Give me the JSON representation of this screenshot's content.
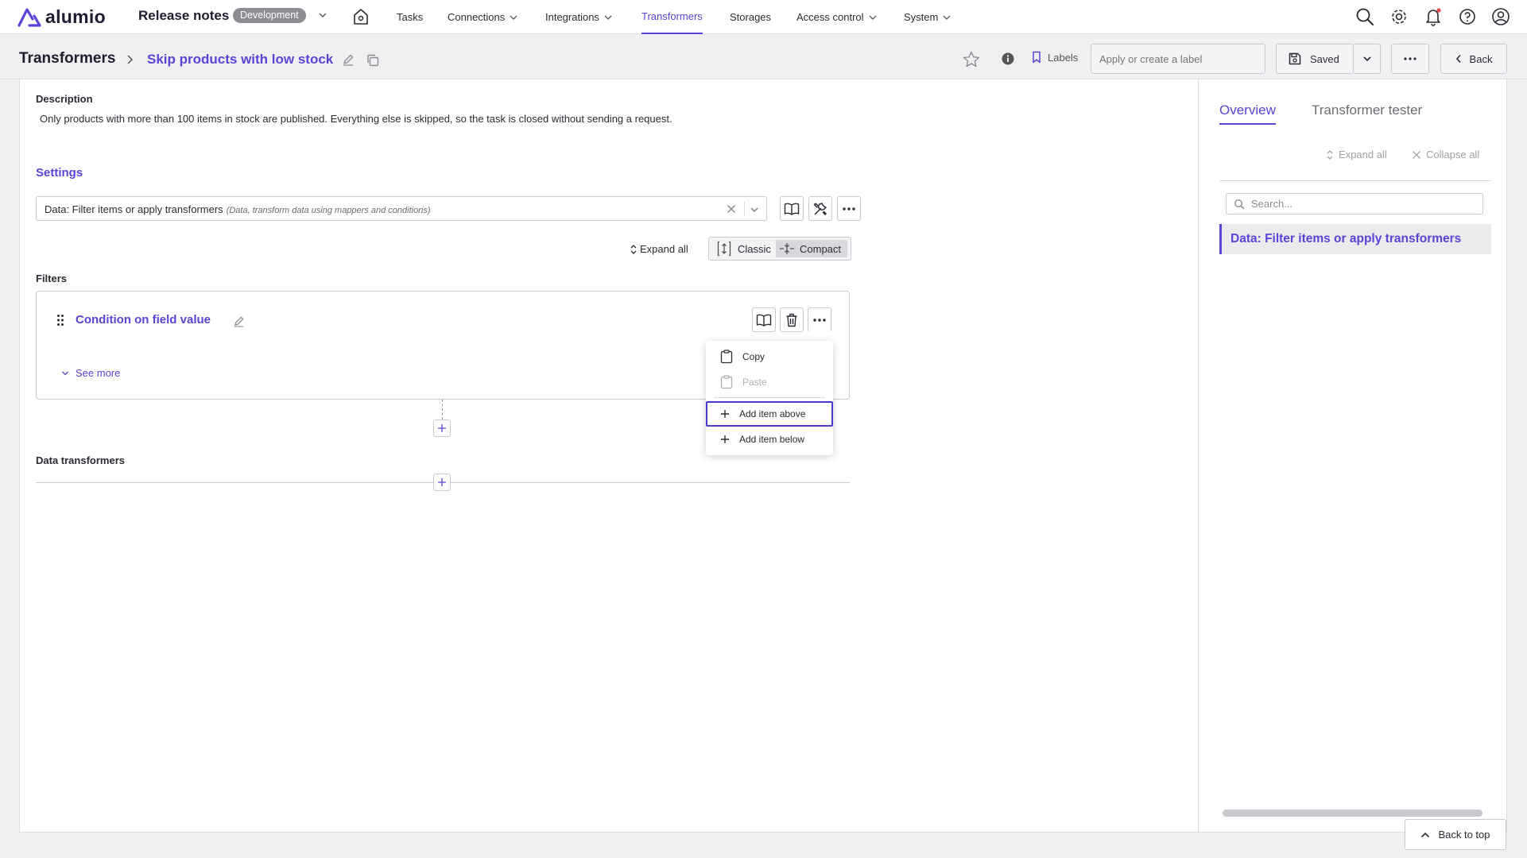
{
  "app": {
    "logo_text": "alumio",
    "title": "Release notes",
    "env_badge": "Development"
  },
  "nav": {
    "items": [
      {
        "label": "Tasks"
      },
      {
        "label": "Connections"
      },
      {
        "label": "Integrations"
      },
      {
        "label": "Transformers"
      },
      {
        "label": "Storages"
      },
      {
        "label": "Access control"
      },
      {
        "label": "System"
      }
    ],
    "active": "Transformers",
    "top_icons": [
      "search-icon",
      "settings-icon",
      "notifications-icon",
      "help-icon",
      "user-icon"
    ]
  },
  "header": {
    "breadcrumb_root": "Transformers",
    "title": "Skip products with low stock",
    "labels_label": "Labels",
    "label_placeholder": "Apply or create a label",
    "saved_label": "Saved",
    "back_label": "Back"
  },
  "main": {
    "description_label": "Description",
    "description_text": "Only products with more than 100 items in stock are published. Everything else is skipped, so the task is closed without sending a request.",
    "settings_title": "Settings",
    "transformer_select": {
      "value": "Data: Filter items or apply transformers",
      "hint": "(Data, transform data using mappers and conditions)"
    },
    "expand_all_label": "Expand all",
    "view_modes": {
      "classic": "Classic",
      "compact": "Compact",
      "selected": "Compact"
    },
    "filters_label": "Filters",
    "filter_item": {
      "title": "Condition on field value",
      "see_more": "See more"
    },
    "data_transformers_label": "Data transformers"
  },
  "context_menu": {
    "items": [
      {
        "label": "Copy",
        "disabled": false
      },
      {
        "label": "Paste",
        "disabled": true
      },
      {
        "label": "Add item above",
        "disabled": false,
        "focused": true
      },
      {
        "label": "Add item below",
        "disabled": false
      }
    ]
  },
  "sidebar": {
    "tabs": [
      {
        "label": "Overview",
        "active": true
      },
      {
        "label": "Transformer tester",
        "active": false
      }
    ],
    "expand_all": "Expand all",
    "collapse_all": "Collapse all",
    "search_placeholder": "Search...",
    "tree_item": "Data: Filter items or apply transformers"
  },
  "footer": {
    "back_to_top": "Back to top"
  },
  "colors": {
    "accent": "#5a43d6",
    "focus_outline": "#4b3bd6",
    "badge": "#8c8c92",
    "notification_dot": "#e5484d"
  }
}
